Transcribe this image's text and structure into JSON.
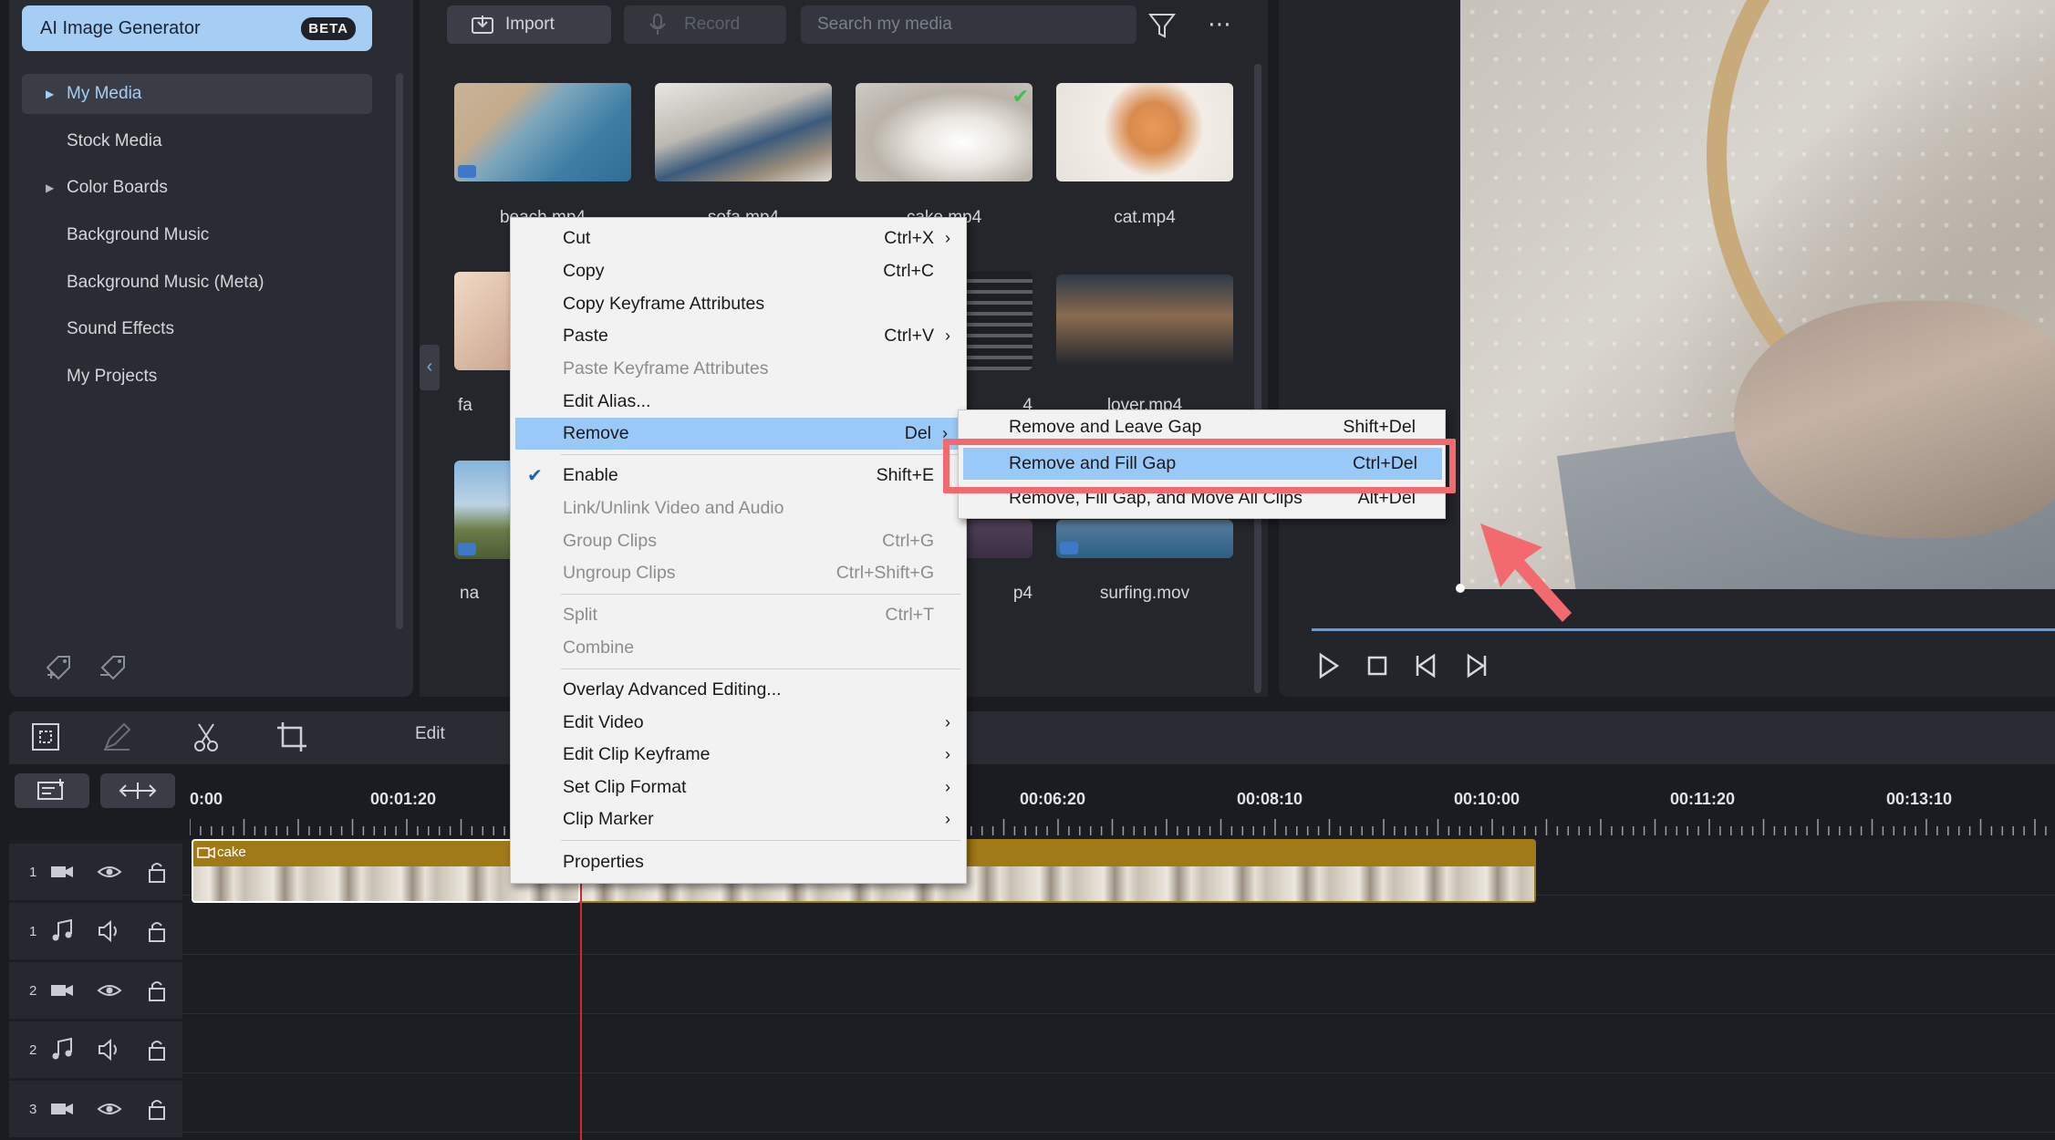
{
  "library": {
    "ai_generator": {
      "label": "AI Image Generator",
      "badge": "BETA"
    },
    "items": [
      {
        "label": "My Media",
        "active": true,
        "expandable": true
      },
      {
        "label": "Stock Media",
        "active": false,
        "expandable": false
      },
      {
        "label": "Color Boards",
        "active": false,
        "expandable": true
      },
      {
        "label": "Background Music",
        "active": false,
        "expandable": false
      },
      {
        "label": "Background Music (Meta)",
        "active": false,
        "expandable": false
      },
      {
        "label": "Sound Effects",
        "active": false,
        "expandable": false
      },
      {
        "label": "My Projects",
        "active": false,
        "expandable": false
      }
    ]
  },
  "media_toolbar": {
    "import_label": "Import",
    "record_label": "Record",
    "search_placeholder": "Search my media"
  },
  "media_items": {
    "beach": "beach.mp4",
    "sofa": "sofa.mp4",
    "cake": "cake.mp4",
    "cat": "cat.mp4",
    "face": "fa",
    "win": "4",
    "lover": "lover.mp4",
    "nature": "na",
    "purple": "p4",
    "surf": "surfing.mov"
  },
  "context_menu": {
    "items": [
      {
        "label": "Cut",
        "shortcut": "Ctrl+X",
        "submenu": true,
        "disabled": false
      },
      {
        "label": "Copy",
        "shortcut": "Ctrl+C",
        "submenu": false,
        "disabled": false
      },
      {
        "label": "Copy Keyframe Attributes",
        "shortcut": "",
        "submenu": false,
        "disabled": false
      },
      {
        "label": "Paste",
        "shortcut": "Ctrl+V",
        "submenu": true,
        "disabled": false
      },
      {
        "label": "Paste Keyframe Attributes",
        "shortcut": "",
        "submenu": false,
        "disabled": true
      },
      {
        "label": "Edit Alias...",
        "shortcut": "",
        "submenu": false,
        "disabled": false
      },
      {
        "label": "Remove",
        "shortcut": "Del",
        "submenu": true,
        "disabled": false,
        "highlighted": true
      },
      {
        "label": "Enable",
        "shortcut": "Shift+E",
        "submenu": false,
        "disabled": false,
        "checked": true
      },
      {
        "label": "Link/Unlink Video and Audio",
        "shortcut": "",
        "submenu": false,
        "disabled": true
      },
      {
        "label": "Group Clips",
        "shortcut": "Ctrl+G",
        "submenu": false,
        "disabled": true
      },
      {
        "label": "Ungroup Clips",
        "shortcut": "Ctrl+Shift+G",
        "submenu": false,
        "disabled": true
      },
      {
        "label": "Split",
        "shortcut": "Ctrl+T",
        "submenu": false,
        "disabled": true
      },
      {
        "label": "Combine",
        "shortcut": "",
        "submenu": false,
        "disabled": true
      },
      {
        "label": "Overlay Advanced Editing...",
        "shortcut": "",
        "submenu": false,
        "disabled": false
      },
      {
        "label": "Edit Video",
        "shortcut": "",
        "submenu": true,
        "disabled": false
      },
      {
        "label": "Edit Clip Keyframe",
        "shortcut": "",
        "submenu": true,
        "disabled": false
      },
      {
        "label": "Set Clip Format",
        "shortcut": "",
        "submenu": true,
        "disabled": false
      },
      {
        "label": "Clip Marker",
        "shortcut": "",
        "submenu": true,
        "disabled": false
      },
      {
        "label": "Properties",
        "shortcut": "",
        "submenu": false,
        "disabled": false
      }
    ],
    "remove_submenu": [
      {
        "label": "Remove and Leave Gap",
        "shortcut": "Shift+Del"
      },
      {
        "label": "Remove and Fill Gap",
        "shortcut": "Ctrl+Del",
        "highlighted": true
      },
      {
        "label": "Remove, Fill Gap, and Move All Clips",
        "shortcut": "Alt+Del"
      }
    ]
  },
  "timeline": {
    "edit_label": "Edit",
    "timecodes": [
      "0:00",
      "00:01:20",
      "00:06:20",
      "00:08:10",
      "00:10:00",
      "00:11:20",
      "00:13:10"
    ],
    "tracks": [
      {
        "number": "1",
        "kind": "video"
      },
      {
        "number": "1",
        "kind": "audio"
      },
      {
        "number": "2",
        "kind": "video"
      },
      {
        "number": "2",
        "kind": "audio"
      },
      {
        "number": "3",
        "kind": "video"
      }
    ],
    "clip_label": "cake"
  },
  "colors": {
    "accent": "#a6cdf4",
    "menu_highlight": "#99c9f8",
    "annotation": "#f26a6e",
    "clip": "#a07a17",
    "playhead": "#d22b2b"
  }
}
